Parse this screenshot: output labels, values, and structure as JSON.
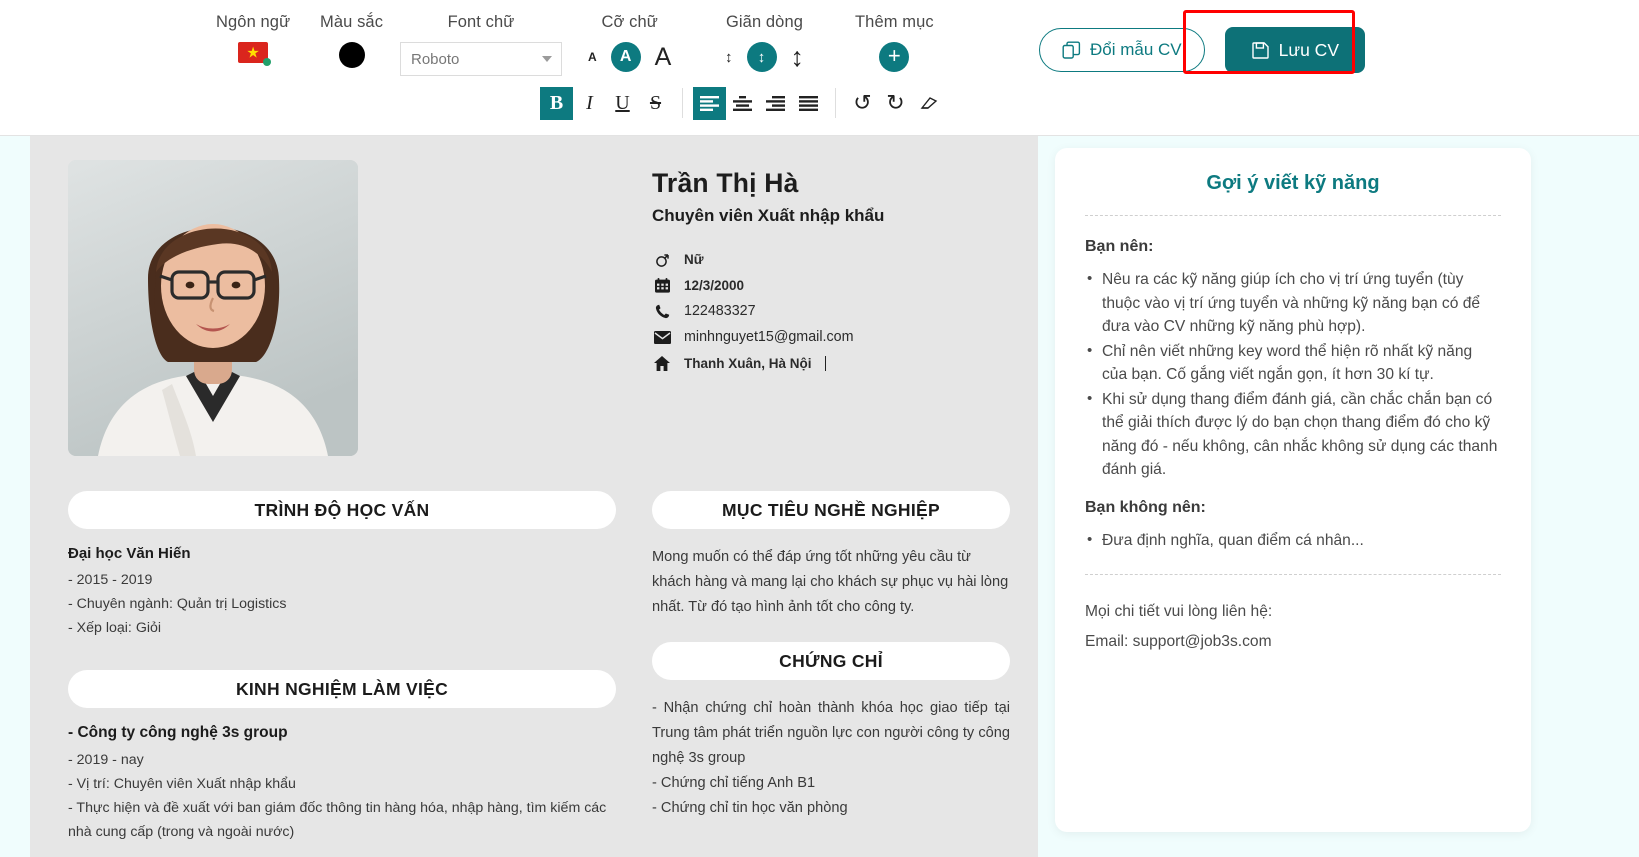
{
  "toolbar": {
    "groups": [
      {
        "label": "Ngôn ngữ",
        "icon": "vietnam-flag-icon"
      },
      {
        "label": "Màu sắc",
        "icon": "color-swatch-icon"
      },
      {
        "label": "Font chữ",
        "value": "Roboto"
      },
      {
        "label": "Cỡ chữ"
      },
      {
        "label": "Giãn dòng"
      },
      {
        "label": "Thêm mục"
      }
    ],
    "format": {
      "bold": "B",
      "italic": "I",
      "underline": "U",
      "strike": "S"
    },
    "change_template_label": "Đổi mẫu CV",
    "save_label": "Lưu CV",
    "accent_color": "#0d7a80",
    "primary_color": "#0d7177",
    "highlight_color": "#ff0000"
  },
  "cv": {
    "name": "Trần Thị Hà",
    "role": "Chuyên viên Xuất nhập khẩu",
    "contact": [
      {
        "icon": "gender-icon",
        "value": "Nữ",
        "bold": true
      },
      {
        "icon": "calendar-icon",
        "value": "12/3/2000",
        "bold": true
      },
      {
        "icon": "phone-icon",
        "value": "122483327",
        "bold": false
      },
      {
        "icon": "email-icon",
        "value": "minhnguyet15@gmail.com",
        "bold": false
      },
      {
        "icon": "home-icon",
        "value": "Thanh Xuân, Hà Nội",
        "bold": true
      }
    ],
    "education": {
      "title": "TRÌNH ĐỘ HỌC VẤN",
      "school": "Đại học Văn Hiến",
      "lines": [
        "- 2015 - 2019",
        "- Chuyên ngành: Quản trị Logistics",
        "- Xếp loại: Giỏi"
      ]
    },
    "experience": {
      "title": "KINH NGHIỆM LÀM VIỆC",
      "company": "- Công ty công nghệ 3s group",
      "lines": [
        "- 2019 - nay",
        "- Vị trí: Chuyên viên Xuất nhập khẩu",
        "- Thực hiện và đề xuất với ban giám đốc thông tin hàng hóa, nhập hàng, tìm kiếm các nhà cung cấp (trong và ngoài nước)"
      ]
    },
    "objective": {
      "title": "MỤC TIÊU NGHỀ NGHIỆP",
      "text": "Mong muốn có thể đáp ứng tốt những yêu cầu từ khách hàng và mang lại cho khách sự phục vụ hài lòng nhất. Từ đó tạo hình ảnh tốt cho công ty."
    },
    "certificate": {
      "title": "CHỨNG CHỈ",
      "text": "- Nhận chứng chỉ hoàn thành khóa học giao tiếp tại Trung tâm phát triển nguồn lực con người công ty công nghệ 3s group",
      "lines": [
        "- Chứng chỉ tiếng Anh B1",
        "- Chứng chỉ tin học văn phòng"
      ]
    }
  },
  "tips": {
    "title": "Gợi ý viết kỹ năng",
    "should_label": "Bạn nên:",
    "should": [
      "Nêu ra các kỹ năng giúp ích cho vị trí ứng tuyển (tùy thuộc vào vị trí ứng tuyển và những kỹ năng bạn có để đưa vào CV những kỹ năng phù hợp).",
      "Chỉ nên viết những key word thể hiện rõ nhất kỹ năng của bạn. Cố gắng viết ngắn gọn, ít hơn 30 kí tự.",
      "Khi sử dụng thang điểm đánh giá, cần chắc chắn bạn có thể giải thích được lý do bạn chọn thang điểm đó cho kỹ năng đó - nếu không, cân nhắc không sử dụng các thanh đánh giá."
    ],
    "should_not_label": "Bạn không nên:",
    "should_not": [
      "Đưa định nghĩa, quan điểm cá nhân..."
    ],
    "contact_line": "Mọi chi tiết vui lòng liên hệ:",
    "contact_email": "Email: support@job3s.com"
  }
}
